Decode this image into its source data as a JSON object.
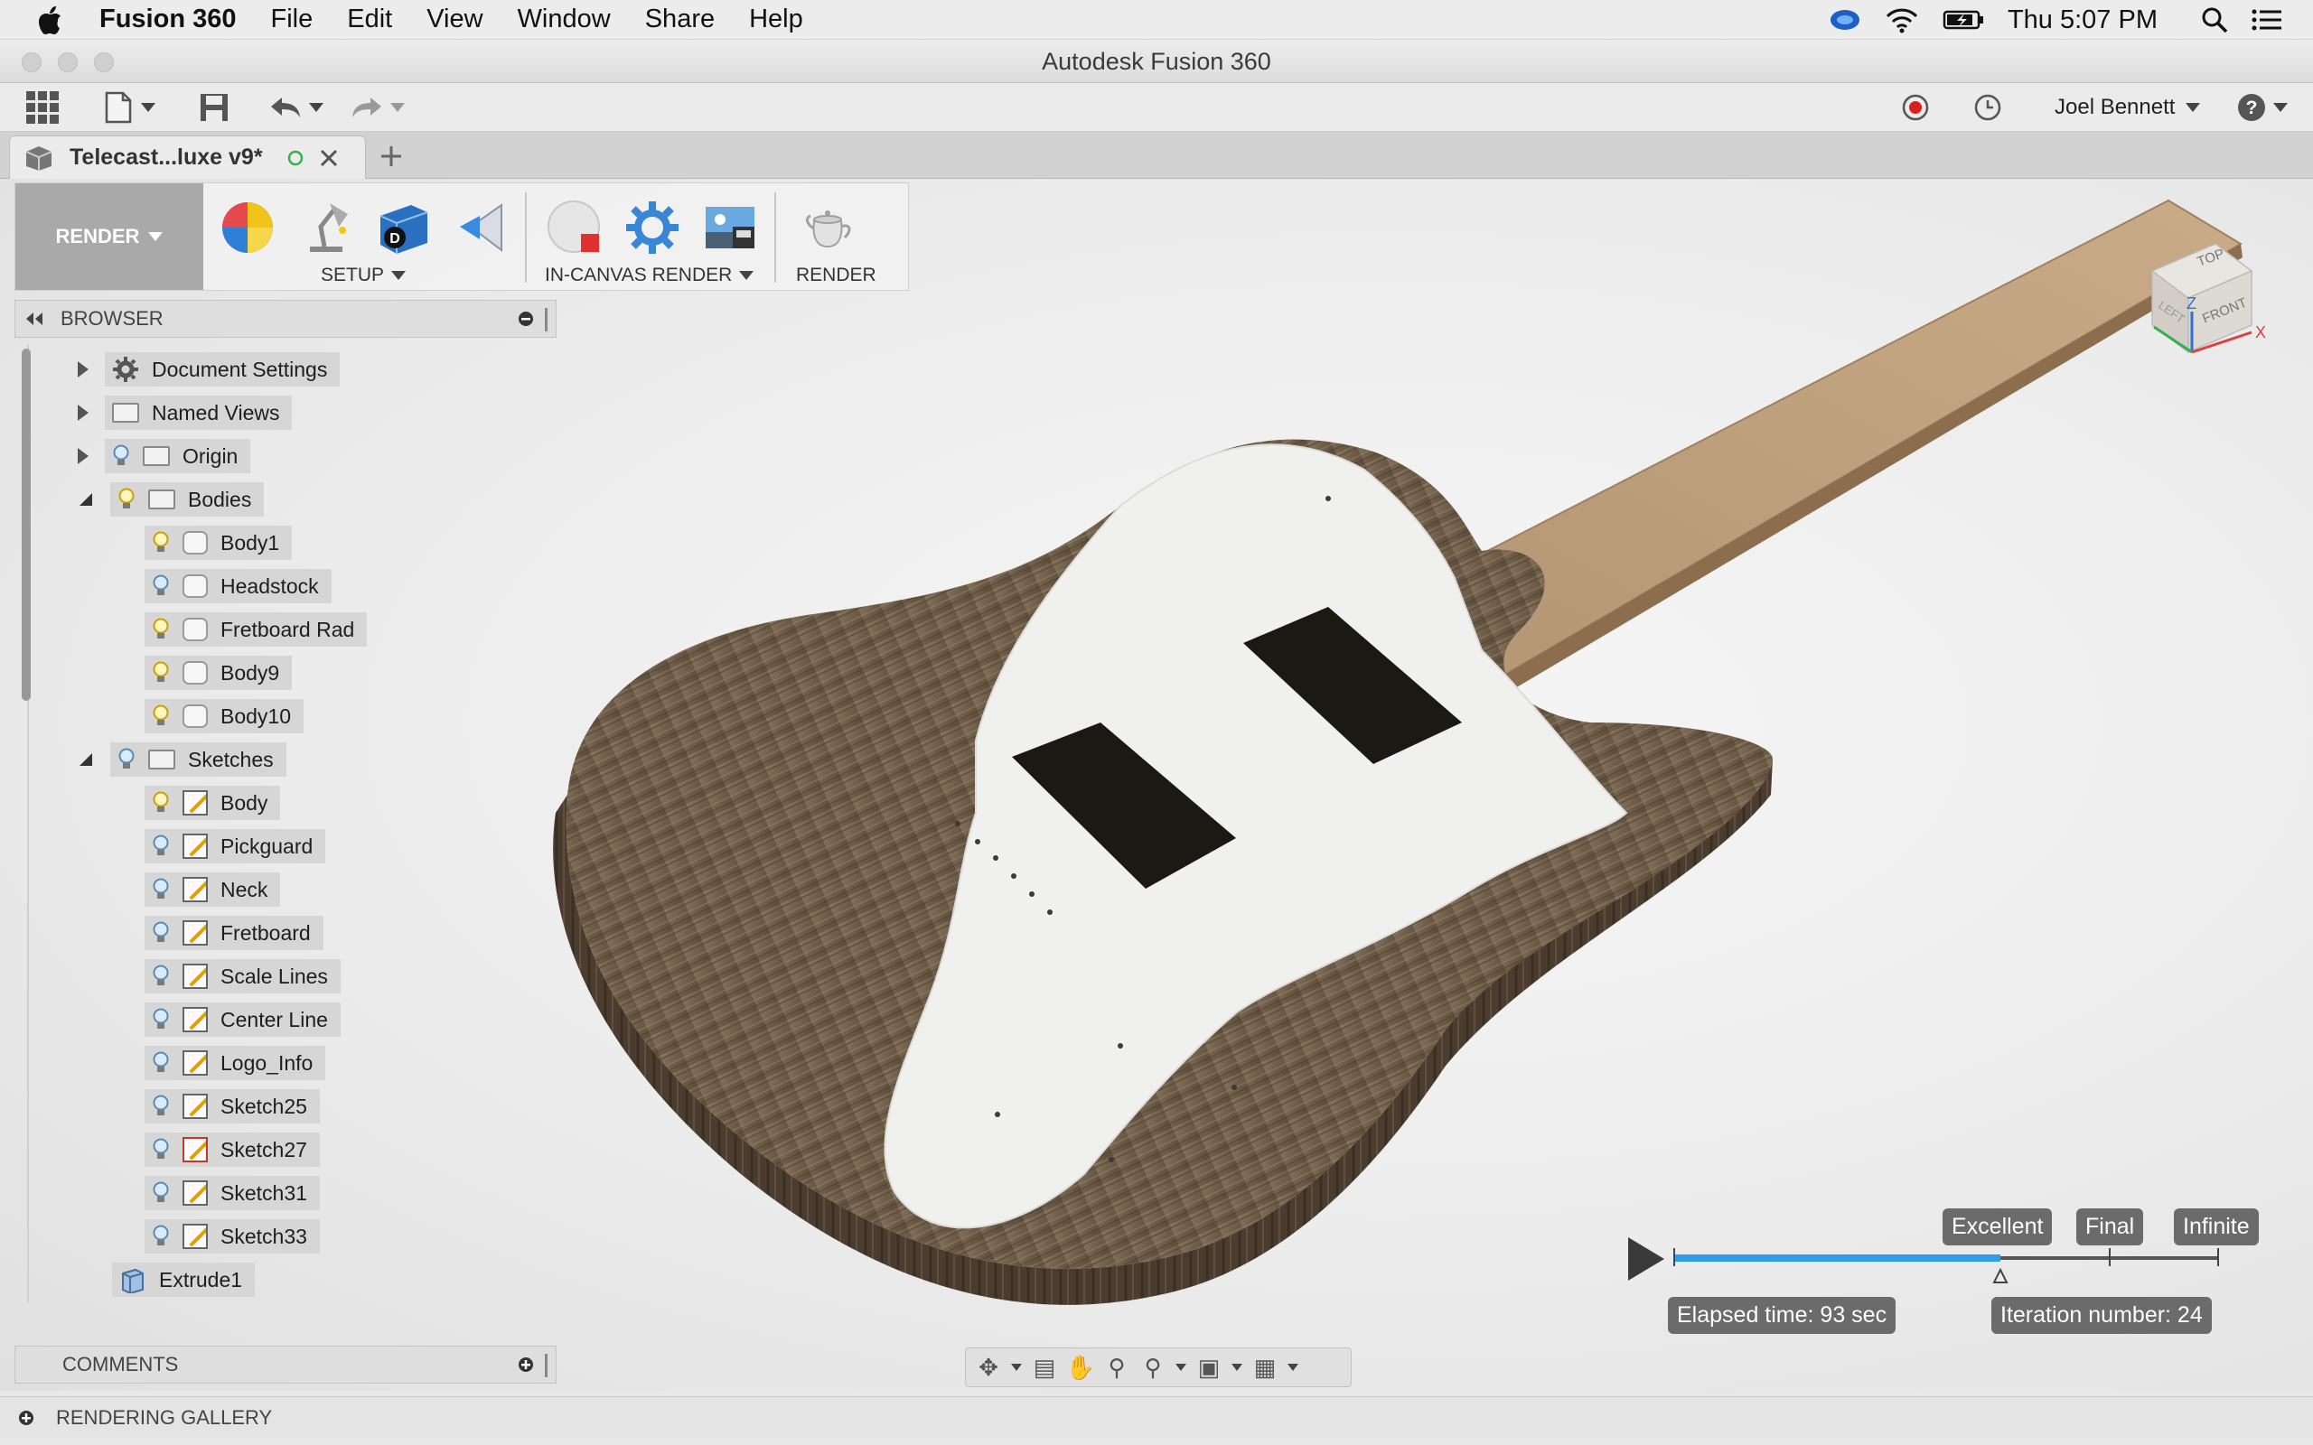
{
  "menubar": {
    "app_name": "Fusion 360",
    "items": [
      "File",
      "Edit",
      "View",
      "Window",
      "Share",
      "Help"
    ],
    "clock": "Thu 5:07 PM"
  },
  "window": {
    "title": "Autodesk Fusion 360"
  },
  "toolbar": {
    "user": "Joel Bennett"
  },
  "document_tab": {
    "label": "Telecast...luxe v9*"
  },
  "ribbon": {
    "workspace": "RENDER",
    "groups": {
      "setup": "SETUP",
      "in_canvas": "IN-CANVAS RENDER",
      "render": "RENDER"
    }
  },
  "browser": {
    "title": "BROWSER",
    "nodes": {
      "document_settings": "Document Settings",
      "named_views": "Named Views",
      "origin": "Origin",
      "bodies": "Bodies",
      "body1": "Body1",
      "headstock": "Headstock",
      "fretboard_rad": "Fretboard Rad",
      "body9": "Body9",
      "body10": "Body10",
      "sketches": "Sketches",
      "sk_body": "Body",
      "sk_pickguard": "Pickguard",
      "sk_neck": "Neck",
      "sk_fretboard": "Fretboard",
      "sk_scale_lines": "Scale Lines",
      "sk_center_line": "Center Line",
      "sk_logo_info": "Logo_Info",
      "sk_sketch25": "Sketch25",
      "sk_sketch27": "Sketch27",
      "sk_sketch31": "Sketch31",
      "sk_sketch33": "Sketch33",
      "extrude1": "Extrude1"
    }
  },
  "comments": {
    "title": "COMMENTS"
  },
  "gallery": {
    "title": "RENDERING GALLERY"
  },
  "viewcube": {
    "top": "TOP",
    "front": "FRONT",
    "left": "LEFT",
    "z": "Z",
    "x": "X"
  },
  "render": {
    "quality_excellent": "Excellent",
    "quality_final": "Final",
    "quality_infinite": "Infinite",
    "elapsed": "Elapsed time: 93 sec",
    "iteration": "Iteration number: 24",
    "progress": 0.6
  },
  "colors": {
    "accent": "#2e9fe6",
    "record": "#d62020"
  }
}
